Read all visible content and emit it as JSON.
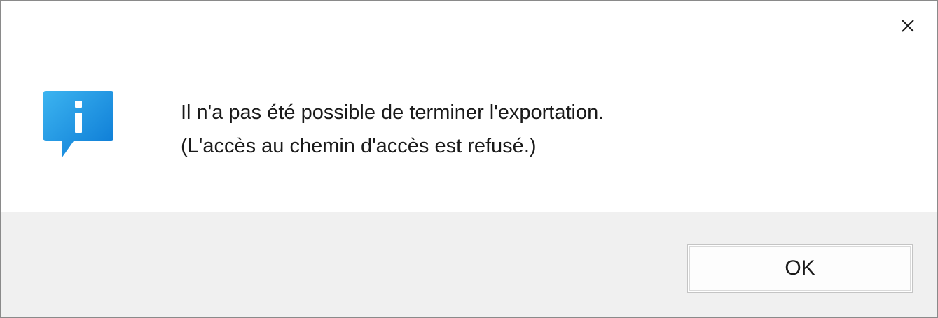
{
  "dialog": {
    "message_lines": [
      "Il n'a pas été possible de terminer l'exportation.",
      "(L'accès au chemin d'accès est refusé.)"
    ],
    "ok_label": "OK",
    "icon": "info-icon",
    "close_icon": "close-icon",
    "colors": {
      "info_icon_top": "#3cb4f0",
      "info_icon_bottom": "#0a78d4",
      "footer_background": "#f0f0f0"
    }
  }
}
